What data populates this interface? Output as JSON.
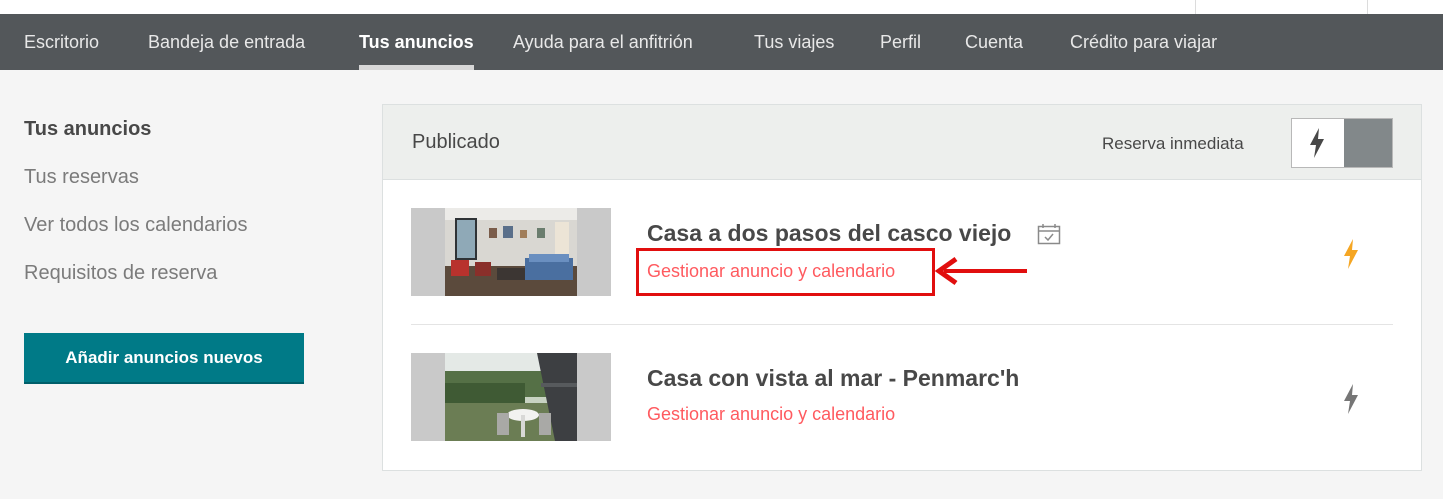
{
  "nav": {
    "items": [
      {
        "label": "Escritorio",
        "active": false
      },
      {
        "label": "Bandeja de entrada",
        "active": false
      },
      {
        "label": "Tus anuncios",
        "active": true
      },
      {
        "label": "Ayuda para el anfitrión",
        "active": false
      },
      {
        "label": "Tus viajes",
        "active": false
      },
      {
        "label": "Perfil",
        "active": false
      },
      {
        "label": "Cuenta",
        "active": false
      },
      {
        "label": "Crédito para viajar",
        "active": false
      }
    ]
  },
  "sidebar": {
    "items": [
      {
        "label": "Tus anuncios",
        "active": true
      },
      {
        "label": "Tus reservas",
        "active": false
      },
      {
        "label": "Ver todos los calendarios",
        "active": false
      },
      {
        "label": "Requisitos de reserva",
        "active": false
      }
    ],
    "add_button": "Añadir anuncios nuevos"
  },
  "panel": {
    "title": "Publicado",
    "instant_book_label": "Reserva inmediata",
    "listings": [
      {
        "title": "Casa a dos pasos del casco viejo",
        "manage_label": "Gestionar anuncio y calendario",
        "instant_book": true,
        "icon": "calendar-check-icon"
      },
      {
        "title": "Casa con vista al mar - Penmarc'h",
        "manage_label": "Gestionar anuncio y calendario",
        "instant_book": false
      }
    ]
  },
  "colors": {
    "nav_bg": "#53575a",
    "accent_teal": "#007a87",
    "link_red": "#ff5a5f",
    "bolt_active": "#f5a623",
    "bolt_inactive": "#767676",
    "annotation_red": "#e10e0e"
  }
}
